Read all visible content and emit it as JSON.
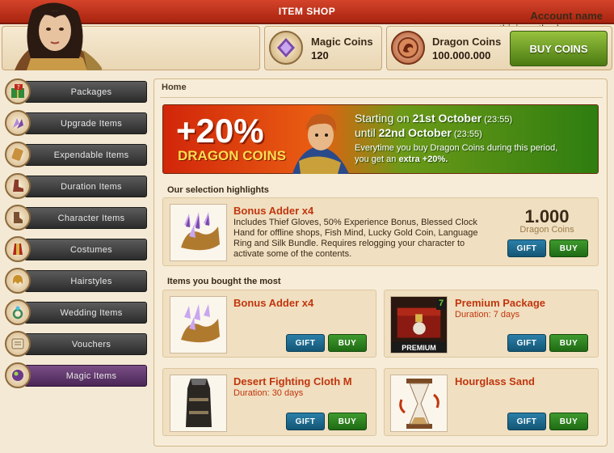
{
  "window": {
    "title": "ITEM SHOP"
  },
  "account": {
    "label": "Account name",
    "value": "thisisaratherlongname"
  },
  "magic_coins": {
    "label": "Magic Coins",
    "value": "120"
  },
  "dragon_coins": {
    "label": "Dragon Coins",
    "value": "100.000.000"
  },
  "buy_coins_label": "BUY COINS",
  "sidebar": {
    "items": [
      {
        "label": "Packages",
        "icon": "gift-box-icon"
      },
      {
        "label": "Upgrade Items",
        "icon": "crystal-icon"
      },
      {
        "label": "Expendable Items",
        "icon": "scroll-icon"
      },
      {
        "label": "Duration Items",
        "icon": "boot-icon"
      },
      {
        "label": "Character Items",
        "icon": "character-icon"
      },
      {
        "label": "Costumes",
        "icon": "costume-icon"
      },
      {
        "label": "Hairstyles",
        "icon": "hair-icon"
      },
      {
        "label": "Wedding Items",
        "icon": "ring-icon"
      },
      {
        "label": "Vouchers",
        "icon": "voucher-icon"
      },
      {
        "label": "Magic Items",
        "icon": "magic-orb-icon",
        "active": true
      }
    ]
  },
  "breadcrumb": "Home",
  "banner": {
    "percent": "+20%",
    "coins": "DRAGON COINS",
    "line1_prefix": "Starting on ",
    "line1_date": "21st October",
    "line1_time": " (23:55)",
    "line2_prefix": "until ",
    "line2_date": "22nd October",
    "line2_time": " (23:55)",
    "desc_line1": "Everytime you buy Dragon Coins during this period,",
    "desc_line2_prefix": "you get an ",
    "desc_line2_bold": "extra +20%."
  },
  "highlights": {
    "title": "Our selection highlights",
    "item": {
      "name": "Bonus Adder x4",
      "description": "Includes Thief Gloves, 50% Experience Bonus, Blessed Clock Hand for offline shops, Fish Mind, Lucky Gold Coin, Language Ring and Silk Bundle. Requires relogging your character to activate some of the contents.",
      "price": "1.000",
      "currency": "Dragon Coins"
    }
  },
  "most_bought": {
    "title": "Items you bought the most",
    "items": [
      {
        "name": "Bonus Adder x4",
        "sub": ""
      },
      {
        "name": "Premium Package",
        "sub": "Duration: 7 days",
        "badge": "PREMIUM",
        "count": "7"
      },
      {
        "name": "Desert Fighting Cloth M",
        "sub": "Duration: 30 days"
      },
      {
        "name": "Hourglass Sand",
        "sub": ""
      }
    ]
  },
  "buttons": {
    "gift": "GIFT",
    "buy": "BUY"
  },
  "colors": {
    "accent_red": "#c0360e",
    "buy_green": "#2f8a20",
    "gift_blue": "#1d6a90",
    "title_red": "#b82f16"
  }
}
